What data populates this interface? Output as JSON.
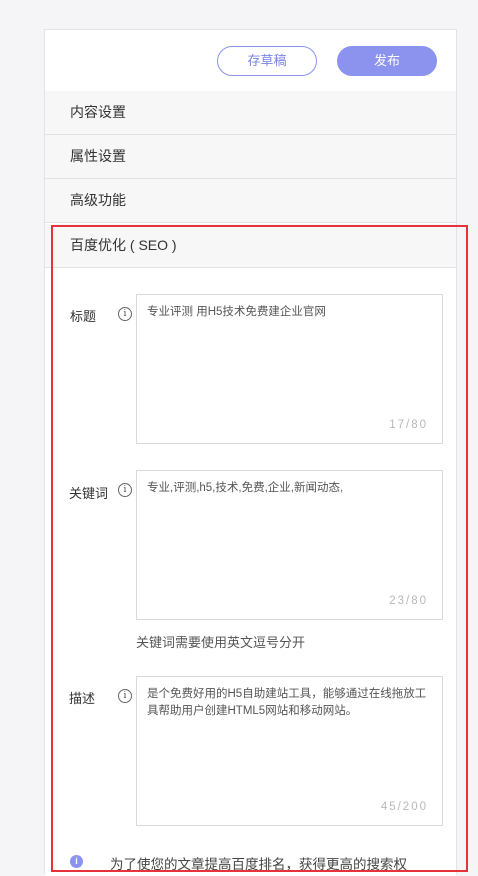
{
  "toolbar": {
    "draft_label": "存草稿",
    "publish_label": "发布"
  },
  "sections": {
    "content": "内容设置",
    "attributes": "属性设置",
    "advanced": "高级功能",
    "seo": "百度优化 ( SEO )"
  },
  "seo": {
    "title": {
      "label": "标题",
      "value": "专业评测 用H5技术免费建企业官网",
      "count": "17/80"
    },
    "keywords": {
      "label": "关键词",
      "value": "专业,评测,h5,技术,免费,企业,新闻动态,",
      "count": "23/80",
      "hint": "关键词需要使用英文逗号分开"
    },
    "description": {
      "label": "描述",
      "value": "是个免费好用的H5自助建站工具，能够通过在线拖放工具帮助用户创建HTML5网站和移动网站。",
      "count": "45/200"
    },
    "tip": "为了使您的文章提高百度排名，获得更高的搜索权"
  },
  "colors": {
    "accent": "#8b93ef",
    "highlight": "#e5323b"
  },
  "icons": {
    "info": "ⓘ",
    "tip": "i"
  }
}
